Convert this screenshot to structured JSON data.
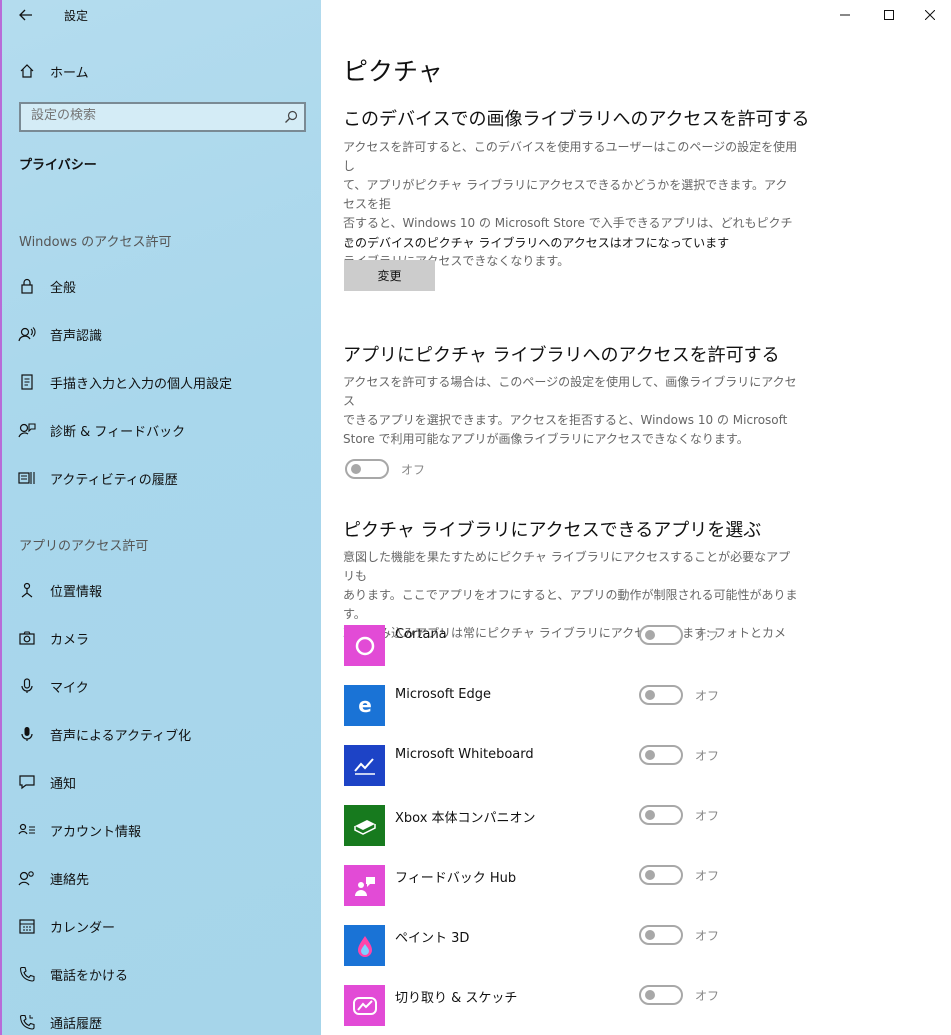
{
  "window": {
    "title": "設定",
    "back_icon": "back-arrow-icon",
    "controls": [
      "minimize-icon",
      "maximize-icon",
      "close-icon"
    ]
  },
  "sidebar": {
    "home_label": "ホーム",
    "search_placeholder": "設定の検索",
    "privacy_heading": "プライバシー",
    "windows_section": "Windows のアクセス許可",
    "windows_items": [
      {
        "label": "全般",
        "icon": "lock-icon"
      },
      {
        "label": "音声認識",
        "icon": "speech-icon"
      },
      {
        "label": "手描き入力と入力の個人用設定",
        "icon": "inking-icon"
      },
      {
        "label": "診断 & フィードバック",
        "icon": "feedback-icon"
      },
      {
        "label": "アクティビティの履歴",
        "icon": "activity-icon"
      }
    ],
    "apps_section": "アプリのアクセス許可",
    "app_items": [
      {
        "label": "位置情報",
        "icon": "location-icon"
      },
      {
        "label": "カメラ",
        "icon": "camera-icon"
      },
      {
        "label": "マイク",
        "icon": "microphone-icon"
      },
      {
        "label": "音声によるアクティブ化",
        "icon": "voice-activation-icon"
      },
      {
        "label": "通知",
        "icon": "notification-icon"
      },
      {
        "label": "アカウント情報",
        "icon": "account-info-icon"
      },
      {
        "label": "連絡先",
        "icon": "contacts-icon"
      },
      {
        "label": "カレンダー",
        "icon": "calendar-icon"
      },
      {
        "label": "電話をかける",
        "icon": "phone-icon"
      },
      {
        "label": "通話履歴",
        "icon": "call-history-icon"
      }
    ]
  },
  "main": {
    "page_title": "ピクチャ",
    "section1": {
      "heading": "このデバイスでの画像ライブラリへのアクセスを許可する",
      "description_lines": [
        "アクセスを許可すると、このデバイスを使用するユーザーはこのページの設定を使用し",
        "て、アプリがピクチャ ライブラリにアクセスできるかどうかを選択できます。アクセスを拒",
        "否すると、Windows 10 の Microsoft Store で入手できるアプリは、どれもピクチャ",
        "ライブラリにアクセスできなくなります。"
      ],
      "status": "このデバイスのピクチャ ライブラリへのアクセスはオフになっています",
      "button_label": "変更"
    },
    "section2": {
      "heading": "アプリにピクチャ ライブラリへのアクセスを許可する",
      "description_lines": [
        "アクセスを許可する場合は、このページの設定を使用して、画像ライブラリにアクセス",
        "できるアプリを選択できます。アクセスを拒否すると、Windows 10 の Microsoft",
        "Store で利用可能なアプリが画像ライブラリにアクセスできなくなります。"
      ],
      "toggle_label": "オフ",
      "toggle_on": false
    },
    "section3": {
      "heading": "ピクチャ ライブラリにアクセスできるアプリを選ぶ",
      "description_lines": [
        "意図した機能を果たすためにピクチャ ライブラリにアクセスすることが必要なアプリも",
        "あります。ここでアプリをオフにすると、アプリの動作が制限される可能性があります。",
        "次の組み込みアプリは常にピクチャ ライブラリにアクセスできます: フォトとカメラ。"
      ],
      "apps": [
        {
          "name": "Cortana",
          "toggle_label": "オフ",
          "icon": "cortana-icon",
          "color": "#e24bd6"
        },
        {
          "name": "Microsoft Edge",
          "toggle_label": "オフ",
          "icon": "edge-icon",
          "color": "#1a73d6"
        },
        {
          "name": "Microsoft Whiteboard",
          "toggle_label": "オフ",
          "icon": "whiteboard-icon",
          "color": "#1d43c6"
        },
        {
          "name": "Xbox 本体コンパニオン",
          "toggle_label": "オフ",
          "icon": "xbox-icon",
          "color": "#177a1e"
        },
        {
          "name": "フィードバック Hub",
          "toggle_label": "オフ",
          "icon": "feedback-hub-icon",
          "color": "#e24bd6"
        },
        {
          "name": "ペイント 3D",
          "toggle_label": "オフ",
          "icon": "paint3d-icon",
          "color": "#1a73d6"
        },
        {
          "name": "切り取り & スケッチ",
          "toggle_label": "オフ",
          "icon": "snip-sketch-icon",
          "color": "#e24bd6"
        }
      ]
    }
  }
}
